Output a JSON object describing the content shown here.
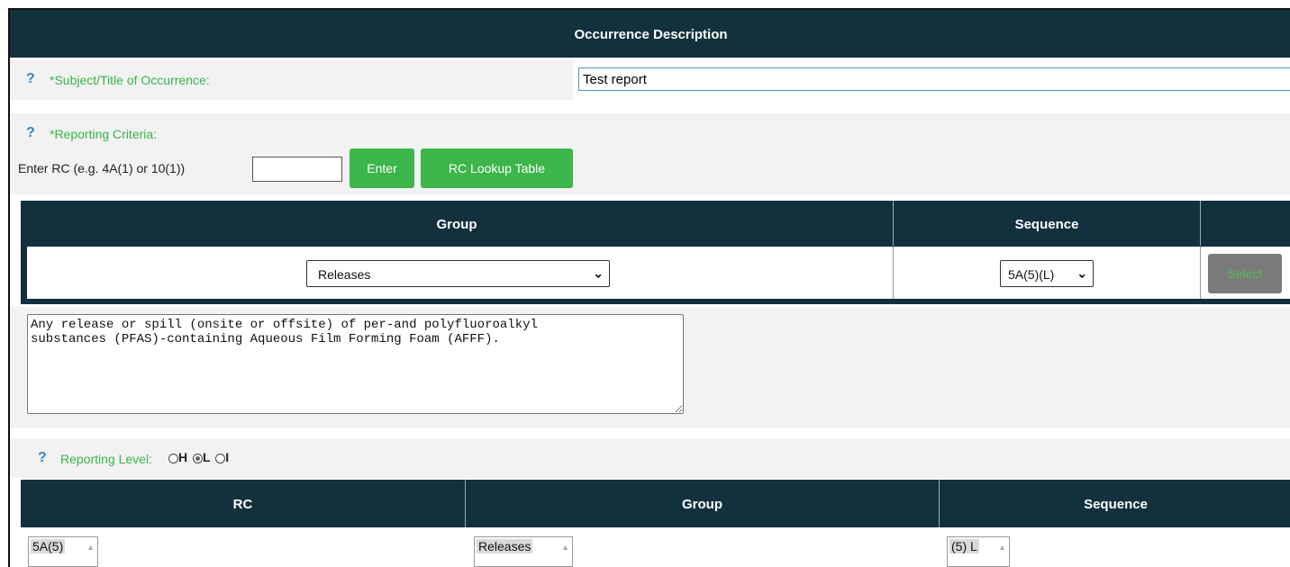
{
  "header": {
    "title": "Occurrence Description"
  },
  "subject": {
    "help": "?",
    "label": "*Subject/Title of Occurrence:",
    "value": "Test report"
  },
  "criteria": {
    "help": "?",
    "label": "*Reporting Criteria:",
    "enter_prompt": "Enter RC (e.g. 4A(1) or 10(1))",
    "rc_value": "",
    "enter_button": "Enter",
    "lookup_button": "RC Lookup Table"
  },
  "selector_table": {
    "columns": [
      "Group",
      "Sequence"
    ],
    "group_selected": "Releases",
    "sequence_selected": "5A(5)(L)",
    "select_button": "Select"
  },
  "description_text": "Any release or spill (onsite or offsite) of per-and polyfluoroalkyl\nsubstances (PFAS)-containing Aqueous Film Forming Foam (AFFF).",
  "reporting_level": {
    "help": "?",
    "label": "Reporting Level:",
    "options": [
      "H",
      "L",
      "I"
    ],
    "selected": "L"
  },
  "result_table": {
    "columns": [
      "RC",
      "Group",
      "Sequence"
    ],
    "row": [
      "5A(5)",
      "Releases",
      "(5) L"
    ]
  },
  "colors": {
    "header_bg": "#12313d",
    "accent_green": "#39b54a",
    "help_blue": "#2f86c6"
  }
}
